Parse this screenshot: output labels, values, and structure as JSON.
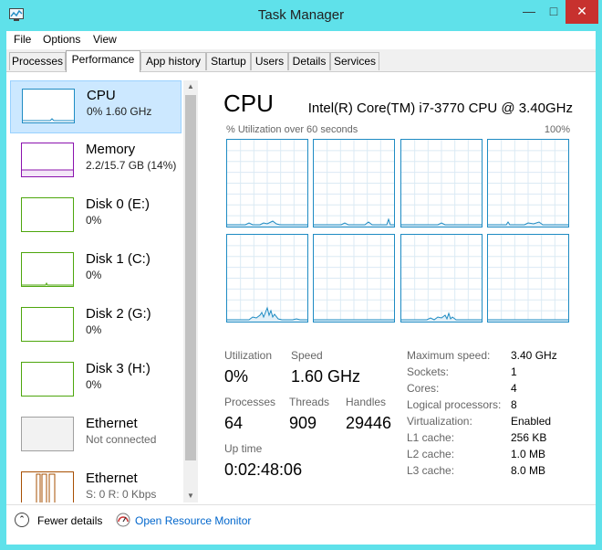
{
  "window": {
    "title": "Task Manager"
  },
  "menu": [
    "File",
    "Options",
    "View"
  ],
  "tabs": [
    "Processes",
    "Performance",
    "App history",
    "Startup",
    "Users",
    "Details",
    "Services"
  ],
  "resources": [
    {
      "name": "CPU",
      "sub": "0% 1.60 GHz",
      "color": "#1e8bc3",
      "selected": true
    },
    {
      "name": "Memory",
      "sub": "2.2/15.7 GB (14%)",
      "color": "#8b12ae"
    },
    {
      "name": "Disk 0 (E:)",
      "sub": "0%",
      "color": "#4da60c"
    },
    {
      "name": "Disk 1 (C:)",
      "sub": "0%",
      "color": "#4da60c"
    },
    {
      "name": "Disk 2 (G:)",
      "sub": "0%",
      "color": "#4da60c"
    },
    {
      "name": "Disk 3 (H:)",
      "sub": "0%",
      "color": "#4da60c"
    },
    {
      "name": "Ethernet",
      "sub": "Not connected",
      "color": "#a0a0a0"
    },
    {
      "name": "Ethernet",
      "sub": "S: 0 R: 0 Kbps",
      "color": "#a74f01"
    }
  ],
  "cpu": {
    "title": "CPU",
    "model": "Intel(R) Core(TM) i7-3770 CPU @ 3.40GHz",
    "graph_caption": "% Utilization over 60 seconds",
    "graph_max": "100%",
    "graph_color": "#1e8bc3"
  },
  "stats": {
    "utilization": {
      "label": "Utilization",
      "value": "0%"
    },
    "speed": {
      "label": "Speed",
      "value": "1.60 GHz"
    },
    "processes": {
      "label": "Processes",
      "value": "64"
    },
    "threads": {
      "label": "Threads",
      "value": "909"
    },
    "handles": {
      "label": "Handles",
      "value": "29446"
    },
    "uptime": {
      "label": "Up time",
      "value": "0:02:48:06"
    }
  },
  "specs": [
    {
      "label": "Maximum speed:",
      "value": "3.40 GHz"
    },
    {
      "label": "Sockets:",
      "value": "1"
    },
    {
      "label": "Cores:",
      "value": "4"
    },
    {
      "label": "Logical processors:",
      "value": "8"
    },
    {
      "label": "Virtualization:",
      "value": "Enabled"
    },
    {
      "label": "L1 cache:",
      "value": "256 KB"
    },
    {
      "label": "L2 cache:",
      "value": "1.0 MB"
    },
    {
      "label": "L3 cache:",
      "value": "8.0 MB"
    }
  ],
  "footer": {
    "fewer_details": "Fewer details",
    "resource_monitor": "Open Resource Monitor"
  }
}
